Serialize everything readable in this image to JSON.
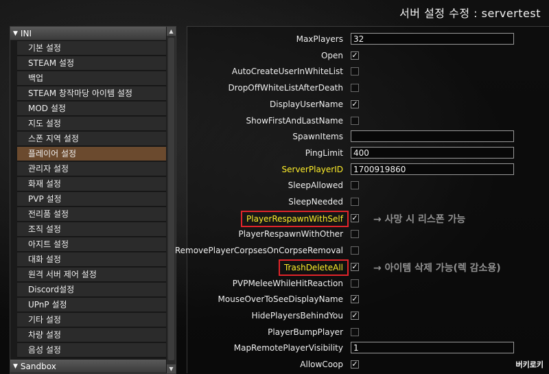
{
  "title": "서버 설정 수정 : servertest",
  "sidebar": {
    "header_ini": "INI",
    "items": [
      {
        "label": "기본 설정"
      },
      {
        "label": "STEAM 설정"
      },
      {
        "label": "백업"
      },
      {
        "label": "STEAM 창작마당 아이템 설정"
      },
      {
        "label": "MOD 설정"
      },
      {
        "label": "지도 설정"
      },
      {
        "label": "스폰 지역 설정"
      },
      {
        "label": "플레이어 설정"
      },
      {
        "label": "관리자 설정"
      },
      {
        "label": "화재 설정"
      },
      {
        "label": "PVP 설정"
      },
      {
        "label": "전리품 설정"
      },
      {
        "label": "조직 설정"
      },
      {
        "label": "아지트 설정"
      },
      {
        "label": "대화 설정"
      },
      {
        "label": "원격 서버 제어 설정"
      },
      {
        "label": "Discord설정"
      },
      {
        "label": "UPnP 설정"
      },
      {
        "label": "기타 설정"
      },
      {
        "label": "차량 설정"
      },
      {
        "label": "음성 설정"
      }
    ],
    "active_index": 7,
    "header_sandbox": "Sandbox"
  },
  "settings": [
    {
      "label": "MaxPlayers",
      "type": "text",
      "value": "32"
    },
    {
      "label": "Open",
      "type": "checkbox",
      "checked": true
    },
    {
      "label": "AutoCreateUserInWhiteList",
      "type": "checkbox",
      "checked": false
    },
    {
      "label": "DropOffWhiteListAfterDeath",
      "type": "checkbox",
      "checked": false
    },
    {
      "label": "DisplayUserName",
      "type": "checkbox",
      "checked": true
    },
    {
      "label": "ShowFirstAndLastName",
      "type": "checkbox",
      "checked": false
    },
    {
      "label": "SpawnItems",
      "type": "text",
      "value": ""
    },
    {
      "label": "PingLimit",
      "type": "text",
      "value": "400"
    },
    {
      "label": "ServerPlayerID",
      "type": "text",
      "value": "1700919860",
      "highlight": true
    },
    {
      "label": "SleepAllowed",
      "type": "checkbox",
      "checked": false
    },
    {
      "label": "SleepNeeded",
      "type": "checkbox",
      "checked": false
    },
    {
      "label": "PlayerRespawnWithSelf",
      "type": "checkbox",
      "checked": true,
      "highlight": true,
      "boxed": true
    },
    {
      "label": "PlayerRespawnWithOther",
      "type": "checkbox",
      "checked": false
    },
    {
      "label": "RemovePlayerCorpsesOnCorpseRemoval",
      "type": "checkbox",
      "checked": false
    },
    {
      "label": "TrashDeleteAll",
      "type": "checkbox",
      "checked": true,
      "highlight": true,
      "boxed": true
    },
    {
      "label": "PVPMeleeWhileHitReaction",
      "type": "checkbox",
      "checked": false
    },
    {
      "label": "MouseOverToSeeDisplayName",
      "type": "checkbox",
      "checked": true
    },
    {
      "label": "HidePlayersBehindYou",
      "type": "checkbox",
      "checked": true
    },
    {
      "label": "PlayerBumpPlayer",
      "type": "checkbox",
      "checked": false
    },
    {
      "label": "MapRemotePlayerVisibility",
      "type": "text",
      "value": "1"
    },
    {
      "label": "AllowCoop",
      "type": "checkbox",
      "checked": true
    }
  ],
  "annotations": {
    "respawn": "→ 사망 시 리스폰 가능",
    "trash": "→ 아이템 삭제 가능(렉 감소용)"
  },
  "watermark": "버키로키",
  "colors": {
    "highlight_text": "#ffef2a",
    "annotation_box": "#e2242a",
    "active_item": "#6b4a2e"
  }
}
